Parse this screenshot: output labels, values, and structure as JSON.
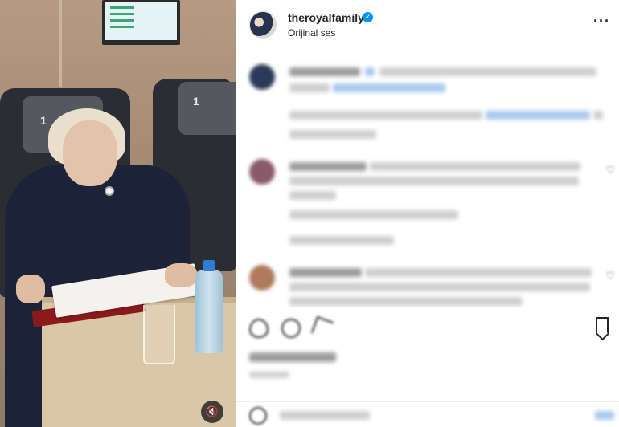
{
  "post": {
    "username": "theroyalfamily",
    "audio_label": "Orijinal ses",
    "more_icon": "more-options-icon",
    "verified_icon": "verified-badge-icon"
  },
  "video": {
    "seat_number": "1",
    "mute_icon": "speaker-muted-icon",
    "mute_glyph": "🔇"
  },
  "colors": {
    "verified": "#0095f6",
    "link_blur": "#a9c8ee",
    "text": "#262626"
  }
}
